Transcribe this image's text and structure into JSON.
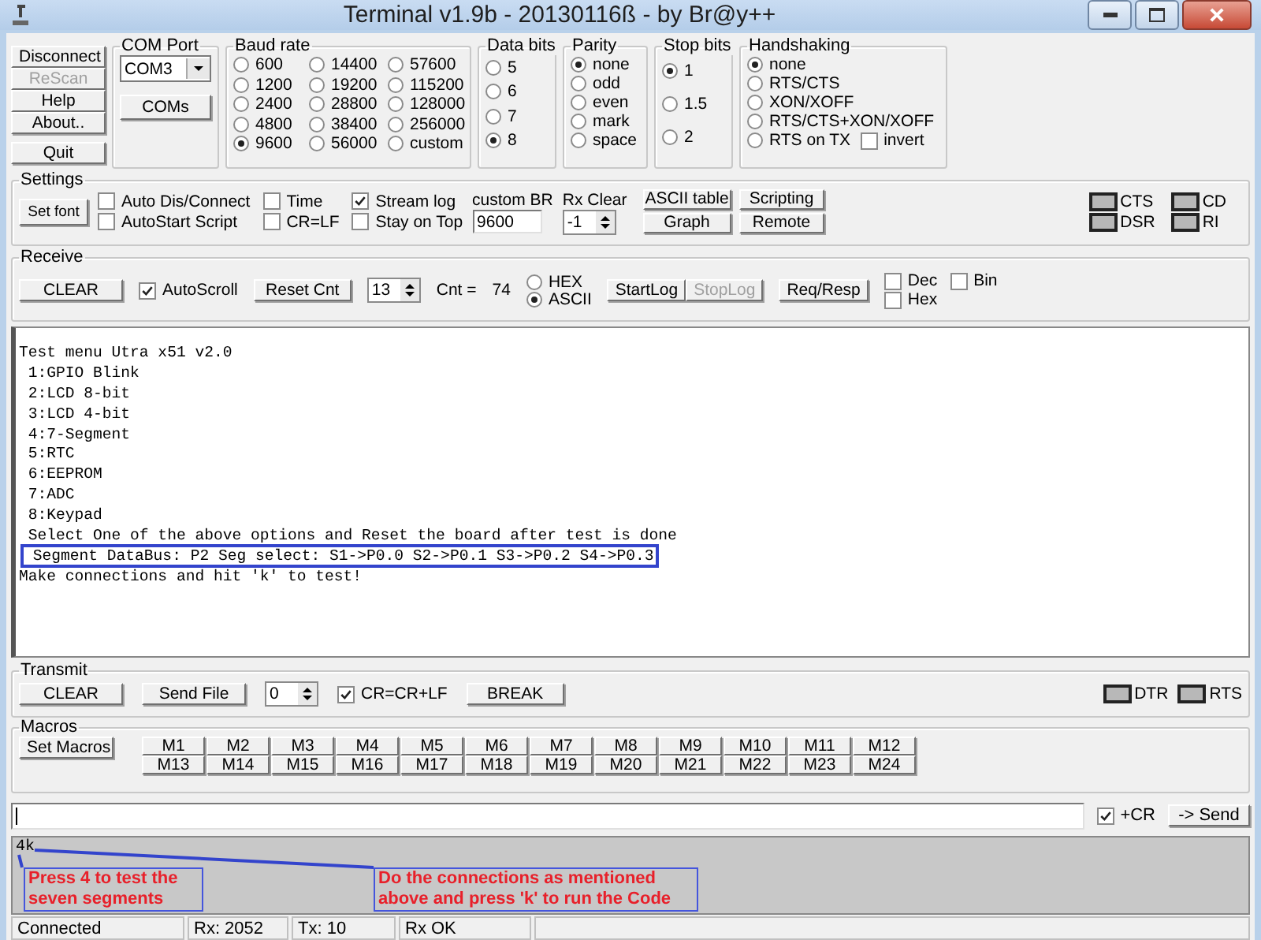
{
  "window": {
    "title": "Terminal v1.9b - 20130116ß - by Br@y++"
  },
  "connection_buttons": [
    {
      "label": "Disconnect",
      "disabled": false
    },
    {
      "label": "ReScan",
      "disabled": true
    },
    {
      "label": "Help",
      "disabled": false
    },
    {
      "label": "About..",
      "disabled": false
    },
    {
      "label": "Quit",
      "disabled": false
    }
  ],
  "com_port": {
    "title": "COM Port",
    "value": "COM3",
    "button": "COMs"
  },
  "baud_rate": {
    "title": "Baud rate",
    "options": [
      {
        "label": "600",
        "selected": false
      },
      {
        "label": "1200",
        "selected": false
      },
      {
        "label": "2400",
        "selected": false
      },
      {
        "label": "4800",
        "selected": false
      },
      {
        "label": "9600",
        "selected": true
      },
      {
        "label": "14400",
        "selected": false
      },
      {
        "label": "19200",
        "selected": false
      },
      {
        "label": "28800",
        "selected": false
      },
      {
        "label": "38400",
        "selected": false
      },
      {
        "label": "56000",
        "selected": false
      },
      {
        "label": "57600",
        "selected": false
      },
      {
        "label": "115200",
        "selected": false
      },
      {
        "label": "128000",
        "selected": false
      },
      {
        "label": "256000",
        "selected": false
      },
      {
        "label": "custom",
        "selected": false
      }
    ]
  },
  "data_bits": {
    "title": "Data bits",
    "options": [
      {
        "label": "5",
        "selected": false
      },
      {
        "label": "6",
        "selected": false
      },
      {
        "label": "7",
        "selected": false
      },
      {
        "label": "8",
        "selected": true
      }
    ]
  },
  "parity": {
    "title": "Parity",
    "options": [
      {
        "label": "none",
        "selected": true
      },
      {
        "label": "odd",
        "selected": false
      },
      {
        "label": "even",
        "selected": false
      },
      {
        "label": "mark",
        "selected": false
      },
      {
        "label": "space",
        "selected": false
      }
    ]
  },
  "stop_bits": {
    "title": "Stop bits",
    "options": [
      {
        "label": "1",
        "selected": true
      },
      {
        "label": "1.5",
        "selected": false
      },
      {
        "label": "2",
        "selected": false
      }
    ]
  },
  "handshaking": {
    "title": "Handshaking",
    "options": [
      {
        "label": "none",
        "selected": true
      },
      {
        "label": "RTS/CTS",
        "selected": false
      },
      {
        "label": "XON/XOFF",
        "selected": false
      },
      {
        "label": "RTS/CTS+XON/XOFF",
        "selected": false
      },
      {
        "label": "RTS on TX",
        "selected": false
      }
    ],
    "invert": {
      "label": "invert",
      "checked": false
    }
  },
  "settings": {
    "title": "Settings",
    "set_font": "Set font",
    "checkboxes": [
      {
        "label": "Auto Dis/Connect",
        "checked": false
      },
      {
        "label": "AutoStart Script",
        "checked": false
      },
      {
        "label": "Time",
        "checked": false
      },
      {
        "label": "CR=LF",
        "checked": false
      },
      {
        "label": "Stream log",
        "checked": true
      },
      {
        "label": "Stay on Top",
        "checked": false
      }
    ],
    "custom_br": {
      "label": "custom BR",
      "value": "9600"
    },
    "rx_clear": {
      "label": "Rx Clear",
      "value": "-1"
    },
    "buttons": [
      "ASCII table",
      "Graph",
      "Scripting",
      "Remote"
    ],
    "indicators": [
      "CTS",
      "CD",
      "DSR",
      "RI"
    ]
  },
  "receive": {
    "title": "Receive",
    "clear": "CLEAR",
    "autoscroll": {
      "label": "AutoScroll",
      "checked": true
    },
    "reset_cnt": "Reset Cnt",
    "count_value": "13",
    "cnt_label": "Cnt =",
    "cnt_value": "74",
    "modes": [
      {
        "label": "HEX",
        "selected": false
      },
      {
        "label": "ASCII",
        "selected": true
      }
    ],
    "log_buttons": [
      {
        "label": "StartLog",
        "disabled": false
      },
      {
        "label": "StopLog",
        "disabled": true
      }
    ],
    "req_resp": "Req/Resp",
    "formats": [
      {
        "label": "Dec",
        "checked": false
      },
      {
        "label": "Hex",
        "checked": false
      },
      {
        "label": "Bin",
        "checked": false
      }
    ]
  },
  "terminal": {
    "lines": [
      {
        "text": "Test menu Utra x51 v2.0",
        "highlighted": false
      },
      {
        "text": " 1:GPIO Blink",
        "highlighted": false
      },
      {
        "text": " 2:LCD 8-bit",
        "highlighted": false
      },
      {
        "text": " 3:LCD 4-bit",
        "highlighted": false
      },
      {
        "text": " 4:7-Segment",
        "highlighted": false
      },
      {
        "text": " 5:RTC",
        "highlighted": false
      },
      {
        "text": " 6:EEPROM",
        "highlighted": false
      },
      {
        "text": " 7:ADC",
        "highlighted": false
      },
      {
        "text": " 8:Keypad",
        "highlighted": false
      },
      {
        "text": " Select One of the above options and Reset the board after test is done",
        "highlighted": false
      },
      {
        "text": " Segment DataBus: P2 Seg select: S1->P0.0 S2->P0.1 S3->P0.2 S4->P0.3",
        "highlighted": true
      },
      {
        "text": "Make connections and hit 'k' to test!",
        "highlighted": false
      }
    ]
  },
  "transmit": {
    "title": "Transmit",
    "clear": "CLEAR",
    "send_file": "Send File",
    "value": "0",
    "crlf": {
      "label": "CR=CR+LF",
      "checked": true
    },
    "break": "BREAK",
    "indicators": [
      "DTR",
      "RTS"
    ]
  },
  "macros": {
    "title": "Macros",
    "set_macros": "Set Macros",
    "buttons": [
      "M1",
      "M2",
      "M3",
      "M4",
      "M5",
      "M6",
      "M7",
      "M8",
      "M9",
      "M10",
      "M11",
      "M12",
      "M13",
      "M14",
      "M15",
      "M16",
      "M17",
      "M18",
      "M19",
      "M20",
      "M21",
      "M22",
      "M23",
      "M24"
    ]
  },
  "send": {
    "cr": {
      "label": "+CR",
      "checked": true
    },
    "button": "-> Send"
  },
  "output": {
    "text": "4k",
    "callouts": [
      "Press 4 to test the seven segments",
      "Do the connections as mentioned above and press 'k' to run the Code"
    ]
  },
  "status_bar": [
    "Connected",
    "Rx: 2052",
    "Tx: 10",
    "Rx OK"
  ]
}
